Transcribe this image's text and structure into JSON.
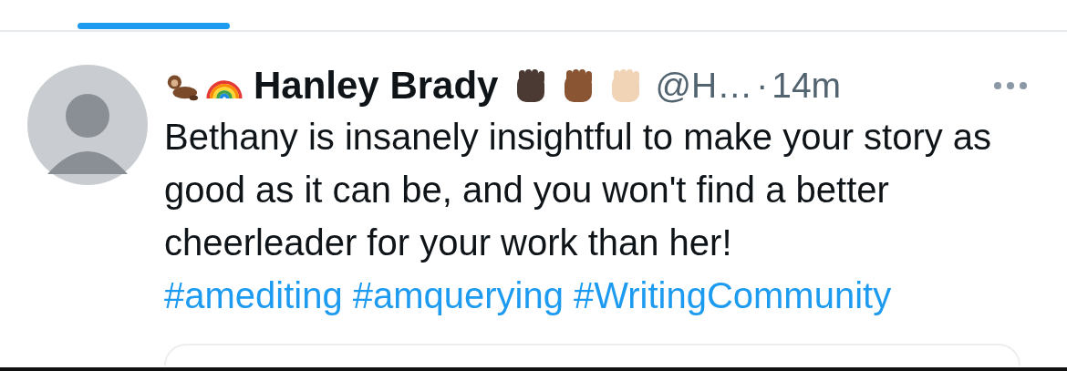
{
  "tweet": {
    "author": {
      "name": "Hanley Brady",
      "handle": "@H…",
      "separator": "·",
      "time": "14m"
    },
    "text": "Bethany is insanely insightful to make your story as good as it can be, and you won't find a better cheerleader for your work than her!",
    "hashtags": [
      "#amediting",
      "#amquerying",
      "#WritingCommunity"
    ]
  }
}
